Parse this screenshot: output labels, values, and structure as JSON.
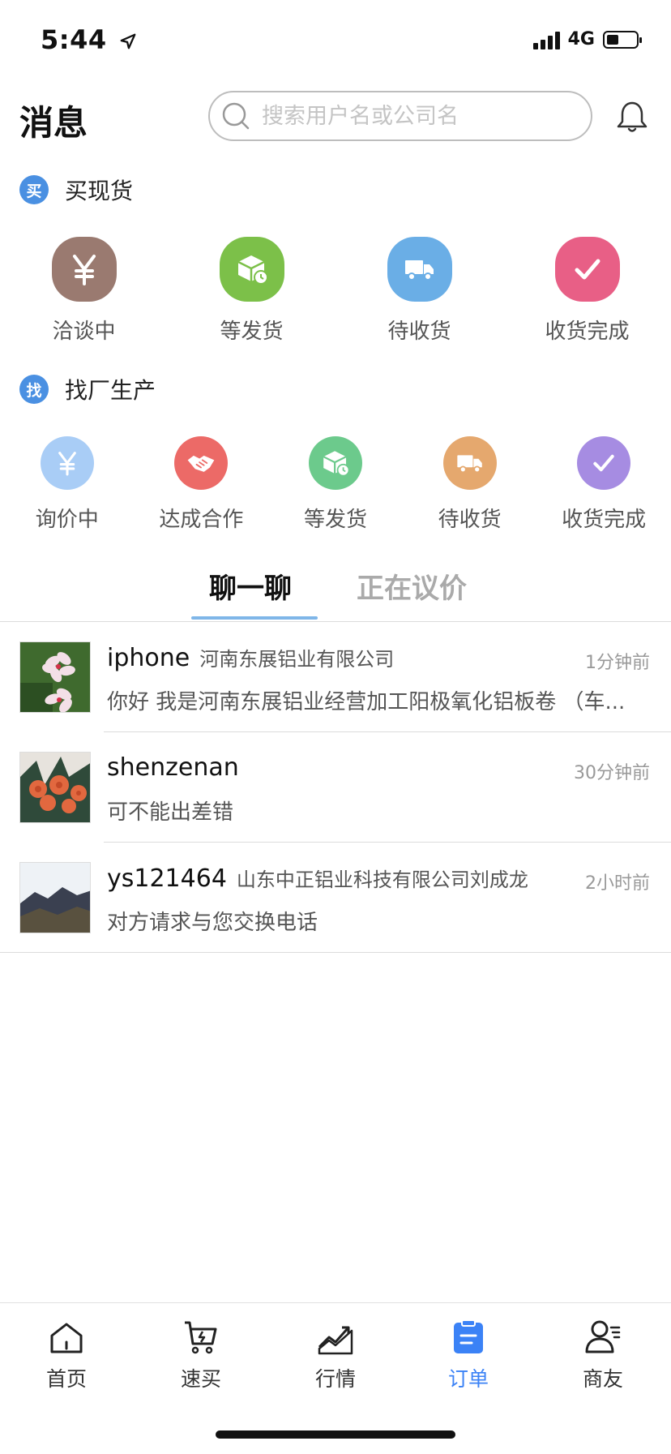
{
  "status_bar": {
    "time": "5:44",
    "network": "4G"
  },
  "header": {
    "title": "消息",
    "search_placeholder": "搜索用户名或公司名"
  },
  "buy_section": {
    "badge": "买",
    "title": "买现货",
    "items": [
      {
        "label": "洽谈中",
        "color": "#9a7a70"
      },
      {
        "label": "等发货",
        "color": "#7cc049"
      },
      {
        "label": "待收货",
        "color": "#6aaee6"
      },
      {
        "label": "收货完成",
        "color": "#e85f86"
      }
    ]
  },
  "factory_section": {
    "badge": "找",
    "title": "找厂生产",
    "items": [
      {
        "label": "询价中",
        "color": "#a9cdf6"
      },
      {
        "label": "达成合作",
        "color": "#ec6a67"
      },
      {
        "label": "等发货",
        "color": "#6cca8c"
      },
      {
        "label": "待收货",
        "color": "#e5a86e"
      },
      {
        "label": "收货完成",
        "color": "#a68ce2"
      }
    ]
  },
  "tabs": {
    "active": "聊一聊",
    "inactive": "正在议价"
  },
  "chats": [
    {
      "name": "iphone",
      "company": "河南东展铝业有限公司",
      "time": "1分钟前",
      "message": "你好 我是河南东展铝业经营加工阳极氧化铝板卷 （车..."
    },
    {
      "name": "shenzenan",
      "company": "",
      "time": "30分钟前",
      "message": "可不能出差错"
    },
    {
      "name": "ys121464",
      "company": "山东中正铝业科技有限公司刘成龙",
      "time": "2小时前",
      "message": "对方请求与您交换电话"
    }
  ],
  "tabbar": [
    {
      "label": "首页",
      "icon": "home-icon"
    },
    {
      "label": "速买",
      "icon": "cart-icon"
    },
    {
      "label": "行情",
      "icon": "chart-icon"
    },
    {
      "label": "订单",
      "icon": "order-icon",
      "active": true
    },
    {
      "label": "商友",
      "icon": "friends-icon"
    }
  ],
  "colors": {
    "accent": "#3b82f6",
    "badge": "#4a90e2"
  }
}
